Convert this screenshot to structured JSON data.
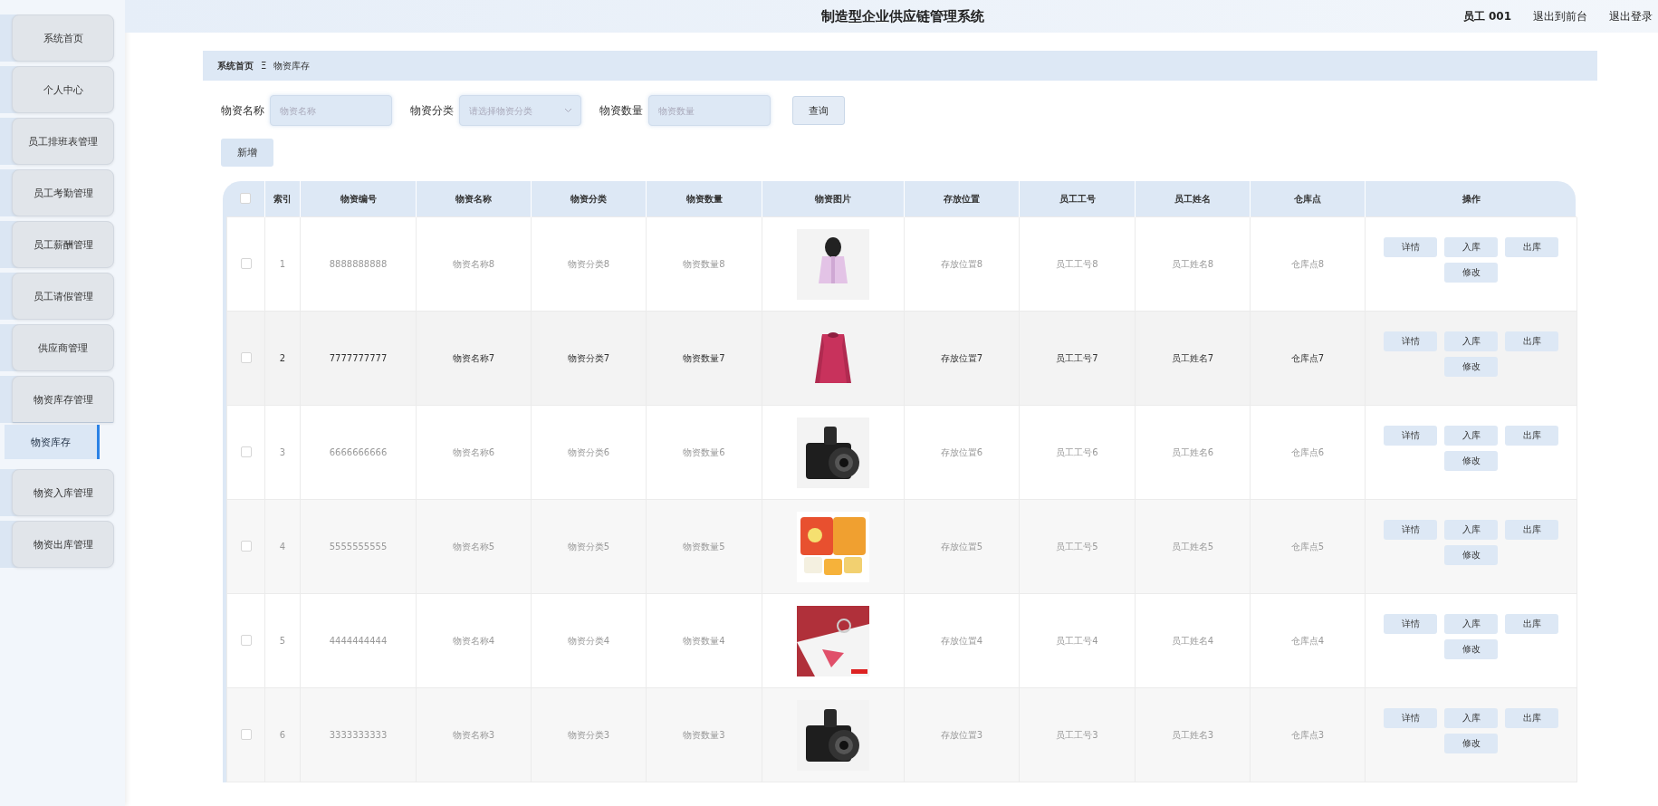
{
  "header": {
    "title": "制造型企业供应链管理系统",
    "user": "员工 001",
    "links": [
      "退出到前台",
      "退出登录"
    ]
  },
  "sidebar": {
    "items": [
      {
        "label": "系统首页",
        "selected": false
      },
      {
        "label": "个人中心",
        "selected": false
      },
      {
        "label": "员工排班表管理",
        "selected": false
      },
      {
        "label": "员工考勤管理",
        "selected": false
      },
      {
        "label": "员工薪酬管理",
        "selected": false
      },
      {
        "label": "员工请假管理",
        "selected": false
      },
      {
        "label": "供应商管理",
        "selected": false
      },
      {
        "label": "物资库存管理",
        "selected": false,
        "expanded": true,
        "children": [
          {
            "label": "物资库存",
            "selected": true
          }
        ]
      },
      {
        "label": "物资入库管理",
        "selected": false
      },
      {
        "label": "物资出库管理",
        "selected": false
      }
    ]
  },
  "breadcrumb": {
    "items": [
      "系统首页",
      "物资库存"
    ],
    "separator": "Ξ"
  },
  "filters": [
    {
      "kind": "input",
      "label": "物资名称",
      "placeholder": "物资名称"
    },
    {
      "kind": "select",
      "label": "物资分类",
      "placeholder": "请选择物资分类"
    },
    {
      "kind": "input",
      "label": "物资数量",
      "placeholder": "物资数量"
    }
  ],
  "search_button": "查询",
  "add_button": "新增",
  "table": {
    "select_all": {
      "checked": false
    },
    "columns": [
      "索引",
      "物资编号",
      "物资名称",
      "物资分类",
      "物资数量",
      "物资图片",
      "存放位置",
      "员工工号",
      "员工姓名",
      "仓库点",
      "操作"
    ],
    "rows": [
      {
        "checked": false,
        "hovered": false,
        "index": "1",
        "code": "8888888888",
        "name": "物资名称8",
        "category": "物资分类8",
        "quantity": "物资数量8",
        "location": "存放位置8",
        "employee_no": "员工工号8",
        "employee_name": "员工姓名8",
        "warehouse": "仓库点8",
        "actions": [
          "详情",
          "入库",
          "出库",
          "修改"
        ]
      },
      {
        "checked": false,
        "hovered": true,
        "index": "2",
        "code": "7777777777",
        "name": "物资名称7",
        "category": "物资分类7",
        "quantity": "物资数量7",
        "location": "存放位置7",
        "employee_no": "员工工号7",
        "employee_name": "员工姓名7",
        "warehouse": "仓库点7",
        "actions": [
          "详情",
          "入库",
          "出库",
          "修改"
        ]
      },
      {
        "checked": false,
        "hovered": false,
        "index": "3",
        "code": "6666666666",
        "name": "物资名称6",
        "category": "物资分类6",
        "quantity": "物资数量6",
        "location": "存放位置6",
        "employee_no": "员工工号6",
        "employee_name": "员工姓名6",
        "warehouse": "仓库点6",
        "actions": [
          "详情",
          "入库",
          "出库",
          "修改"
        ]
      },
      {
        "checked": false,
        "hovered": false,
        "index": "4",
        "code": "5555555555",
        "name": "物资名称5",
        "category": "物资分类5",
        "quantity": "物资数量5",
        "location": "存放位置5",
        "employee_no": "员工工号5",
        "employee_name": "员工姓名5",
        "warehouse": "仓库点5",
        "actions": [
          "详情",
          "入库",
          "出库",
          "修改"
        ]
      },
      {
        "checked": false,
        "hovered": false,
        "index": "5",
        "code": "4444444444",
        "name": "物资名称4",
        "category": "物资分类4",
        "quantity": "物资数量4",
        "location": "存放位置4",
        "employee_no": "员工工号4",
        "employee_name": "员工姓名4",
        "warehouse": "仓库点4",
        "actions": [
          "详情",
          "入库",
          "出库",
          "修改"
        ]
      },
      {
        "checked": false,
        "hovered": false,
        "index": "6",
        "code": "3333333333",
        "name": "物资名称3",
        "category": "物资分类3",
        "quantity": "物资数量3",
        "location": "存放位置3",
        "employee_no": "员工工号3",
        "employee_name": "员工姓名3",
        "warehouse": "仓库点3",
        "actions": [
          "详情",
          "入库",
          "出库",
          "修改"
        ]
      }
    ]
  }
}
